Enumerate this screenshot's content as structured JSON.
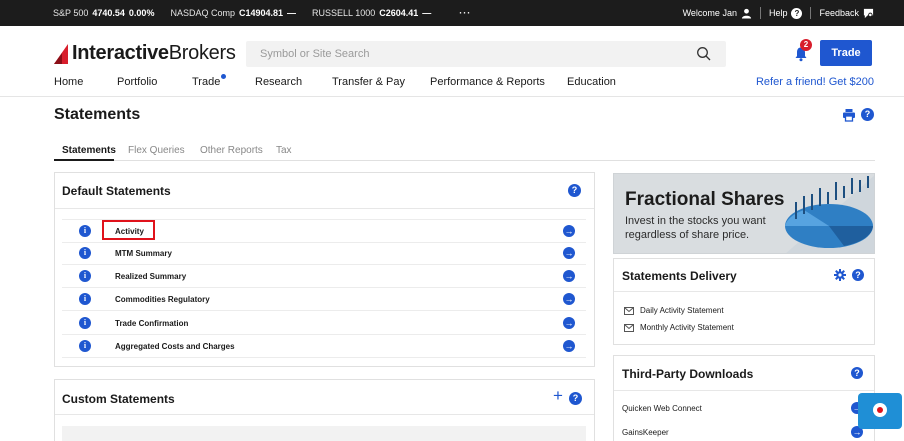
{
  "ticker": {
    "items": [
      {
        "name": "S&P 500",
        "value": "4740.54",
        "change": "0.00%"
      },
      {
        "name": "NASDAQ Comp",
        "value": "C14904.81",
        "change": "—"
      },
      {
        "name": "RUSSELL 1000",
        "value": "C2604.41",
        "change": "—"
      }
    ],
    "more": "···",
    "welcome": "Welcome Jan",
    "help": "Help",
    "feedback": "Feedback"
  },
  "header": {
    "logo_bold": "Interactive",
    "logo_light": "Brokers",
    "search_placeholder": "Symbol or Site Search",
    "notifications_count": "2",
    "trade_label": "Trade"
  },
  "nav": {
    "items": [
      "Home",
      "Portfolio",
      "Trade",
      "Research",
      "Transfer & Pay",
      "Performance & Reports",
      "Education"
    ],
    "refer": "Refer a friend! Get $200"
  },
  "page": {
    "title": "Statements",
    "tabs": [
      "Statements",
      "Flex Queries",
      "Other Reports",
      "Tax"
    ],
    "active_tab": "Statements"
  },
  "default_statements": {
    "title": "Default Statements",
    "rows": [
      "Activity",
      "MTM Summary",
      "Realized Summary",
      "Commodities Regulatory",
      "Trade Confirmation",
      "Aggregated Costs and Charges"
    ]
  },
  "custom_statements": {
    "title": "Custom Statements",
    "add": "+"
  },
  "ad": {
    "title": "Fractional Shares",
    "text": "Invest in the stocks you want regardless of share price."
  },
  "delivery": {
    "title": "Statements Delivery",
    "items": [
      "Daily Activity Statement",
      "Monthly Activity Statement"
    ]
  },
  "downloads": {
    "title": "Third-Party Downloads",
    "items": [
      "Quicken Web Connect",
      "GainsKeeper"
    ]
  },
  "colors": {
    "accent": "#1f57d0",
    "highlight": "#e0121b",
    "ticker_bg": "#1c1c1c"
  }
}
